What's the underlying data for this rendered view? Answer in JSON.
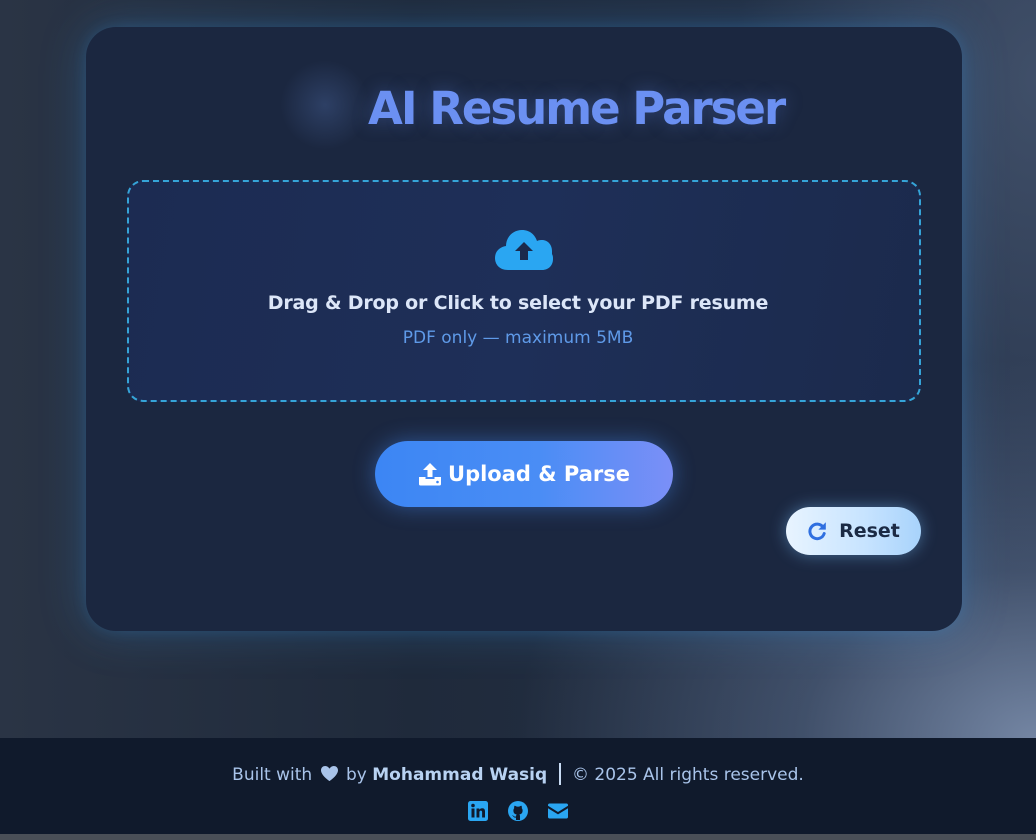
{
  "app": {
    "title": "AI Resume Parser"
  },
  "dropzone": {
    "icon": "cloud-upload-icon",
    "main_text": "Drag & Drop or Click to select your PDF resume",
    "sub_text": "PDF only — maximum 5MB",
    "border_color": "#35a4d8"
  },
  "buttons": {
    "upload_label": "Upload & Parse",
    "upload_icon": "upload-icon",
    "reset_label": "Reset",
    "reset_icon": "refresh-icon"
  },
  "footer": {
    "built_with": "Built with",
    "heart_icon": "heart-icon",
    "by": "by",
    "author": "Mohammad Wasiq",
    "copyright": "© 2025 All rights reserved.",
    "socials": [
      "linkedin-icon",
      "github-icon",
      "email-icon"
    ]
  },
  "colors": {
    "accent": "#3c86f4",
    "title": "#6b90f2",
    "card": "#1b2740",
    "icon_blue": "#2aa6f2"
  }
}
